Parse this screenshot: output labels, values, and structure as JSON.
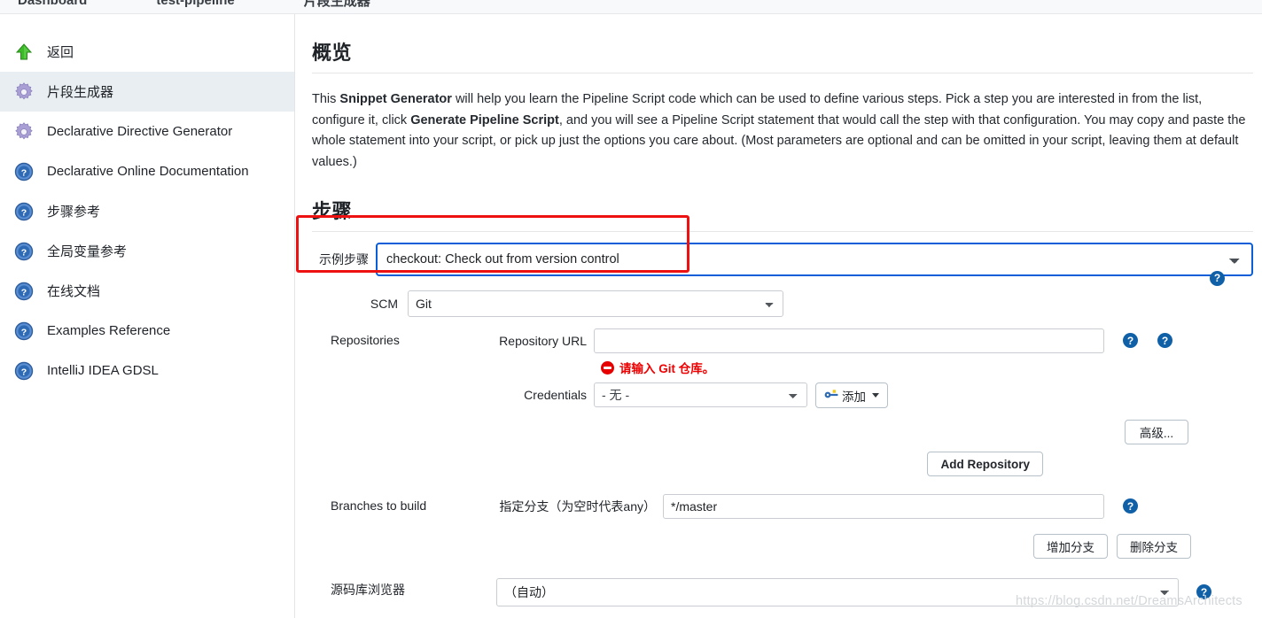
{
  "breadcrumb": {
    "items": [
      "Dashboard",
      "test-pipeline",
      "片段生成器"
    ]
  },
  "sidebar": {
    "items": [
      {
        "label": "返回",
        "icon": "up-arrow-icon",
        "active": false
      },
      {
        "label": "片段生成器",
        "icon": "gear-icon",
        "active": true
      },
      {
        "label": "Declarative Directive Generator",
        "icon": "gear-icon",
        "active": false
      },
      {
        "label": "Declarative Online Documentation",
        "icon": "help-icon",
        "active": false
      },
      {
        "label": "步骤参考",
        "icon": "help-icon",
        "active": false
      },
      {
        "label": "全局变量参考",
        "icon": "help-icon",
        "active": false
      },
      {
        "label": "在线文档",
        "icon": "help-icon",
        "active": false
      },
      {
        "label": "Examples Reference",
        "icon": "help-icon",
        "active": false
      },
      {
        "label": "IntelliJ IDEA GDSL",
        "icon": "help-icon",
        "active": false
      }
    ]
  },
  "overview": {
    "title": "概览",
    "p1": "This ",
    "b1": "Snippet Generator",
    "p2": " will help you learn the Pipeline Script code which can be used to define various steps. Pick a step you are interested in from the list, configure it, click ",
    "b2": "Generate Pipeline Script",
    "p3": ", and you will see a Pipeline Script statement that would call the step with that configuration. You may copy and paste the whole statement into your script, or pick up just the options you care about. (Most parameters are optional and can be omitted in your script, leaving them at default values.)"
  },
  "steps": {
    "title": "步骤",
    "sample_step_label": "示例步骤",
    "sample_step_value": "checkout: Check out from version control"
  },
  "scm": {
    "label": "SCM",
    "value": "Git",
    "repositories_label": "Repositories",
    "repo_url_label": "Repository URL",
    "repo_url_value": "",
    "repo_url_placeholder": "",
    "repo_url_error": "请输入 Git 仓库。",
    "credentials_label": "Credentials",
    "credentials_value": "- 无 -",
    "add_credentials_label": "添加",
    "advanced_label": "高级...",
    "add_repository_label": "Add Repository",
    "branches_label": "Branches to build",
    "branch_spec_label": "指定分支（为空时代表any）",
    "branch_spec_value": "*/master",
    "add_branch_label": "增加分支",
    "delete_branch_label": "删除分支",
    "browser_label": "源码库浏览器",
    "browser_value": "（自动）"
  },
  "icons": {
    "help": "?"
  },
  "watermark": "https://blog.csdn.net/DreamsArchitects",
  "colors": {
    "accent_blue": "#1060a8",
    "focus_blue": "#0b5ed7",
    "annotation_red": "#ee1111",
    "error_red": "#ee0000",
    "active_sidebar_bg": "#e9eef2"
  }
}
